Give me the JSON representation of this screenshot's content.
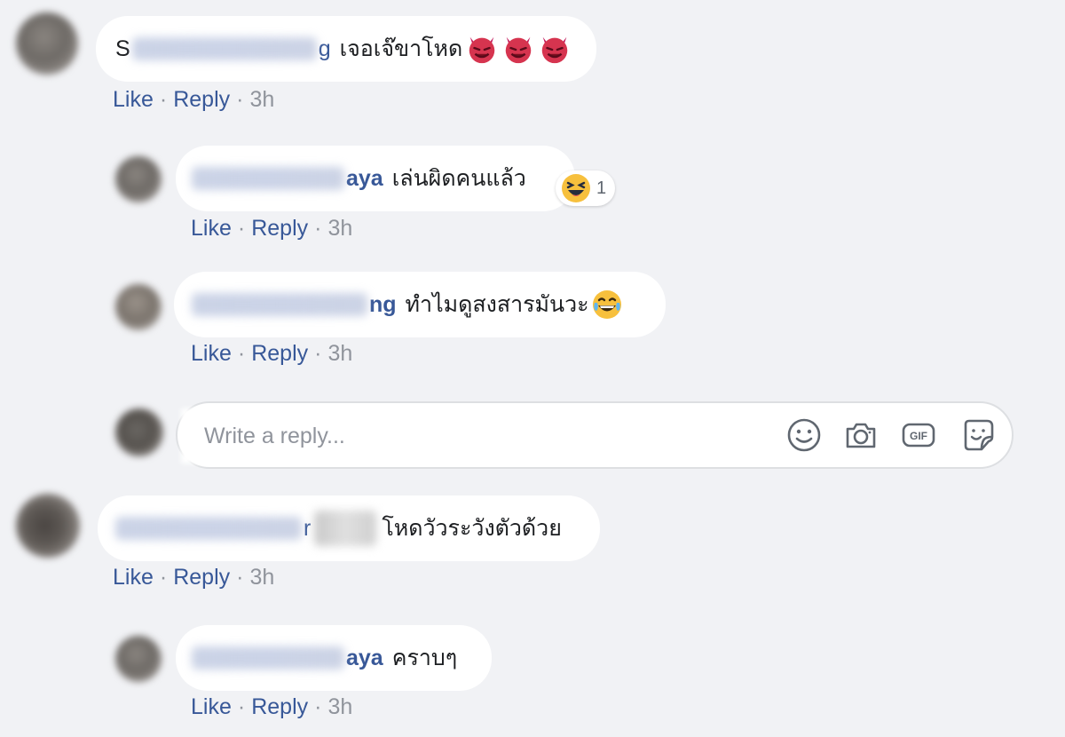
{
  "comments": [
    {
      "name_visible_start": "S",
      "name_visible_end": "g",
      "text": "เจอเจ๊ขาโหด",
      "emoji": [
        "devil-face",
        "devil-face",
        "devil-face"
      ],
      "actions": {
        "like": "Like",
        "reply": "Reply",
        "time": "3h"
      }
    },
    {
      "name_visible_end": "aya",
      "text": "เล่นผิดคนแล้ว",
      "reaction": {
        "icon": "haha-reaction",
        "count": "1"
      },
      "actions": {
        "like": "Like",
        "reply": "Reply",
        "time": "3h"
      }
    },
    {
      "name_visible_end": "ng",
      "text": "ทำไมดูสงสารมันวะ",
      "emoji": [
        "tears-of-joy"
      ],
      "actions": {
        "like": "Like",
        "reply": "Reply",
        "time": "3h"
      }
    },
    {
      "name_visible_end": "r",
      "text": "โหดวัวระวังตัวด้วย",
      "actions": {
        "like": "Like",
        "reply": "Reply",
        "time": "3h"
      }
    },
    {
      "name_visible_end": "aya",
      "text": "คราบๆ",
      "actions": {
        "like": "Like",
        "reply": "Reply",
        "time": "3h"
      }
    }
  ],
  "reply_composer": {
    "placeholder": "Write a reply...",
    "icons": [
      "emoji-icon",
      "camera-icon",
      "gif-icon",
      "sticker-icon"
    ]
  },
  "colors": {
    "background": "#f1f2f5",
    "bubble": "#ffffff",
    "link": "#385898",
    "meta": "#90949c"
  }
}
